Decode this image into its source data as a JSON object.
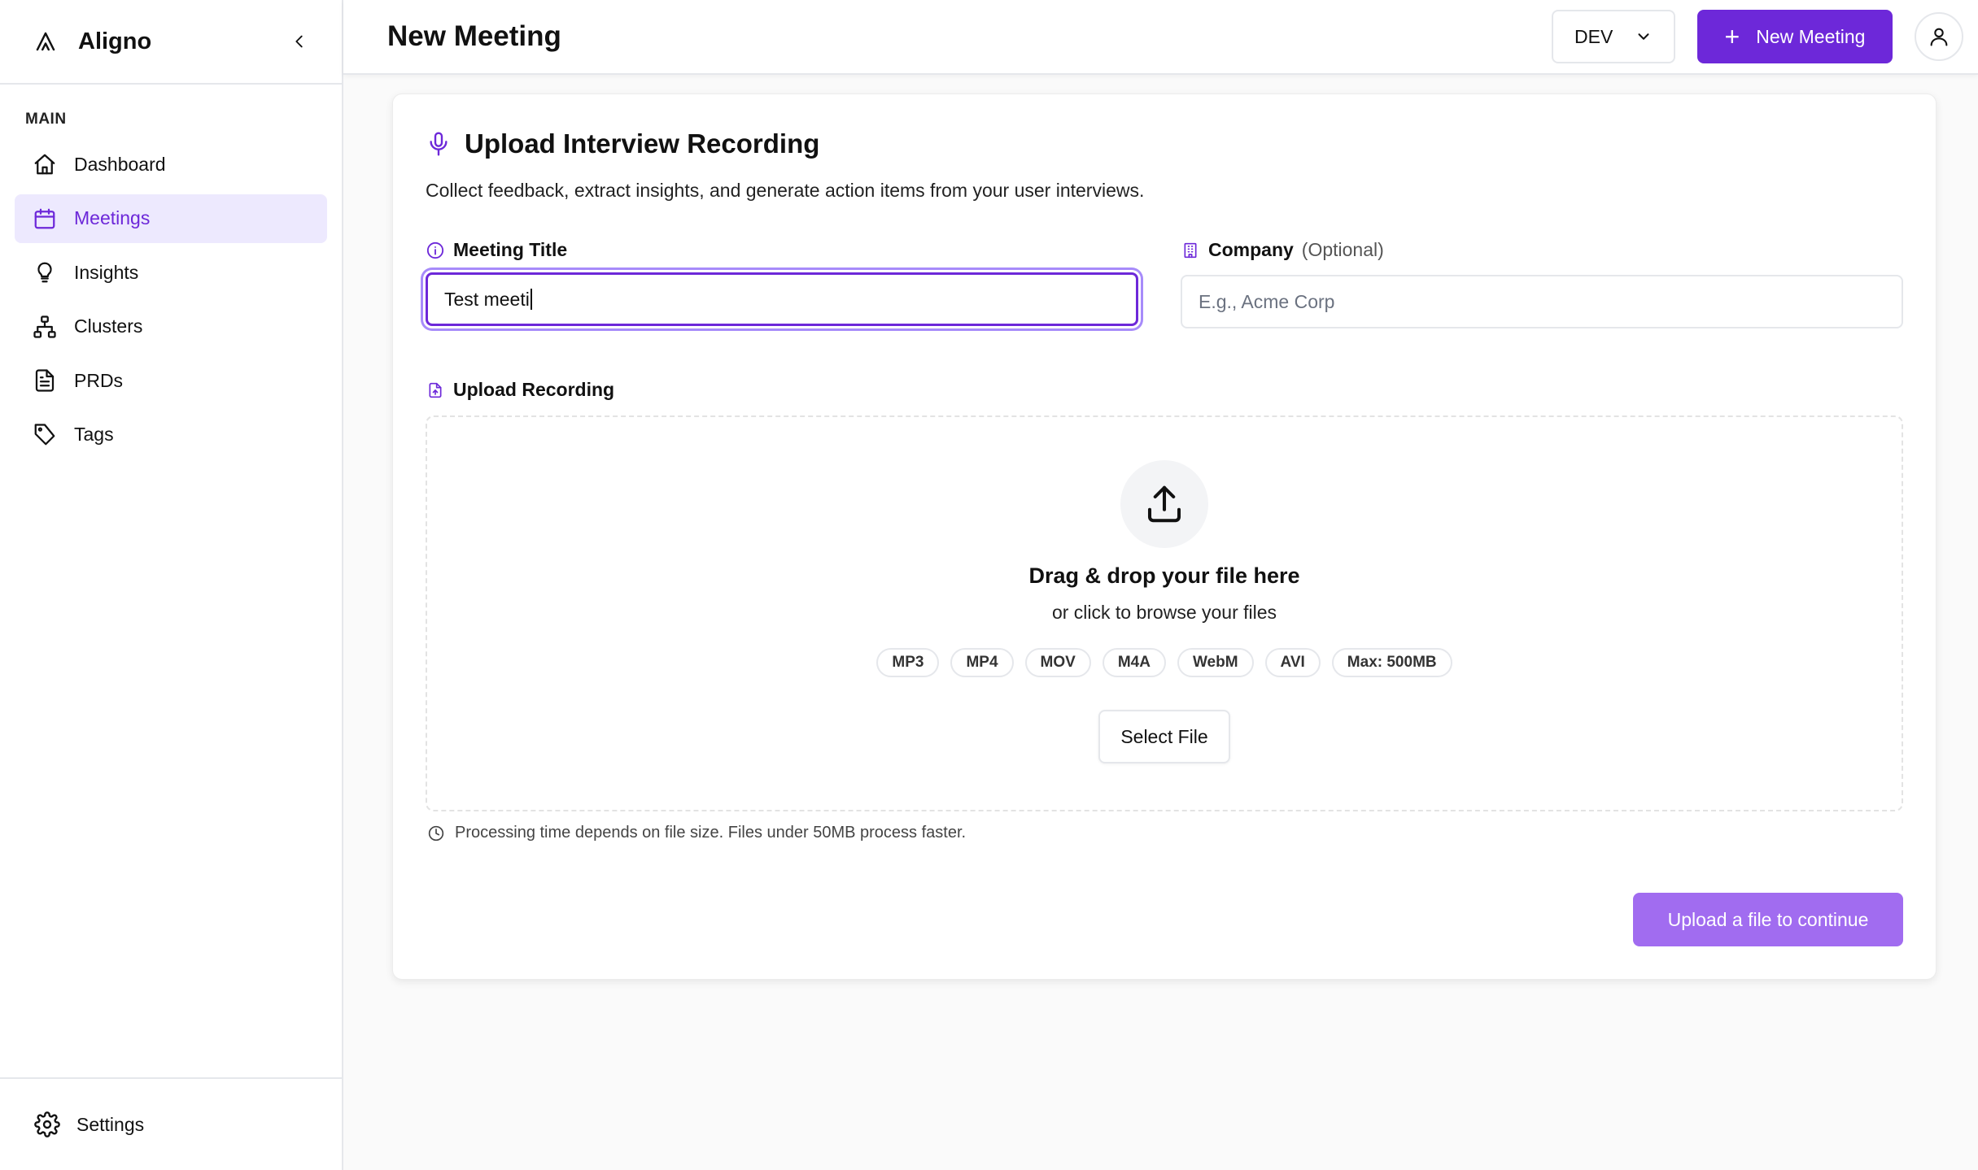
{
  "app": {
    "name": "Aligno"
  },
  "sidebar": {
    "section_label": "MAIN",
    "items": [
      {
        "label": "Dashboard",
        "icon": "home-icon"
      },
      {
        "label": "Meetings",
        "icon": "calendar-icon",
        "active": true
      },
      {
        "label": "Insights",
        "icon": "lightbulb-icon"
      },
      {
        "label": "Clusters",
        "icon": "network-icon"
      },
      {
        "label": "PRDs",
        "icon": "document-icon"
      },
      {
        "label": "Tags",
        "icon": "tag-icon"
      }
    ],
    "footer": {
      "label": "Settings",
      "icon": "gear-icon"
    }
  },
  "header": {
    "title": "New Meeting",
    "env_value": "DEV",
    "new_meeting_label": "New Meeting"
  },
  "card": {
    "title": "Upload Interview Recording",
    "description": "Collect feedback, extract insights, and generate action items from your user interviews.",
    "meeting_title": {
      "label": "Meeting Title",
      "value": "Test meeti"
    },
    "company": {
      "label": "Company",
      "optional": "(Optional)",
      "placeholder": "E.g., Acme Corp"
    },
    "upload": {
      "label": "Upload Recording",
      "title": "Drag & drop your file here",
      "subtitle": "or click to browse your files",
      "formats": [
        "MP3",
        "MP4",
        "MOV",
        "M4A",
        "WebM",
        "AVI",
        "Max: 500MB"
      ],
      "select_label": "Select File"
    },
    "note": "Processing time depends on file size. Files under 50MB process faster.",
    "submit_label": "Upload a file to continue"
  },
  "colors": {
    "accent": "#6d28d9",
    "accent_light": "#ede9fe",
    "submit_disabled": "#a16cf0"
  }
}
